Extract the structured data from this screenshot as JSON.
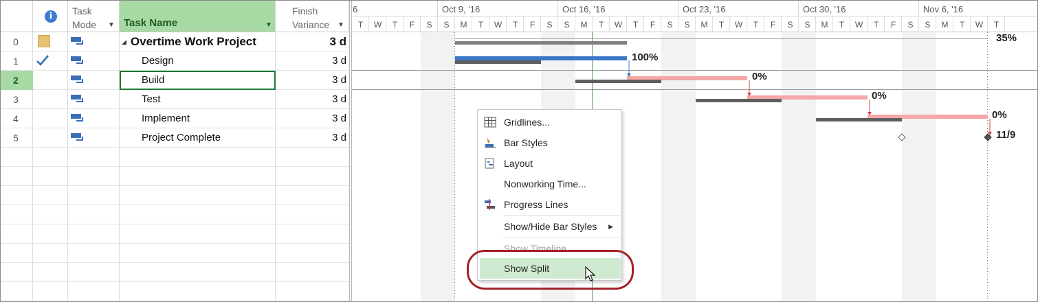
{
  "grid": {
    "headers": {
      "task_mode_line1": "Task",
      "task_mode_line2": "Mode",
      "task_name": "Task Name",
      "finish_variance_line1": "Finish",
      "finish_variance_line2": "Variance",
      "info_glyph": "i"
    },
    "rows": [
      {
        "id": "0",
        "name": "Overtime Work Project",
        "variance": "3 d",
        "indicator": "note-icon"
      },
      {
        "id": "1",
        "name": "Design",
        "variance": "3 d",
        "indicator": "check-icon"
      },
      {
        "id": "2",
        "name": "Build",
        "variance": "3 d",
        "indicator": ""
      },
      {
        "id": "3",
        "name": "Test",
        "variance": "3 d",
        "indicator": ""
      },
      {
        "id": "4",
        "name": "Implement",
        "variance": "3 d",
        "indicator": ""
      },
      {
        "id": "5",
        "name": "Project Complete",
        "variance": "3 d",
        "indicator": ""
      }
    ],
    "selected_row": "2"
  },
  "timescale": {
    "weeks": [
      "6",
      "Oct 9, '16",
      "Oct 16, '16",
      "Oct 23, '16",
      "Oct 30, '16",
      "Nov 6, '16"
    ],
    "day_letters": [
      "T",
      "W",
      "T",
      "F",
      "S",
      "S",
      "M",
      "T",
      "W",
      "T",
      "F",
      "S",
      "S",
      "M",
      "T",
      "W",
      "T",
      "F",
      "S",
      "S",
      "M",
      "T",
      "W",
      "T",
      "F",
      "S",
      "S",
      "M",
      "T",
      "W",
      "T",
      "F",
      "S",
      "S",
      "M",
      "T",
      "W",
      "T"
    ]
  },
  "gantt": {
    "labels": {
      "summary_pct": "35%",
      "design_pct": "100%",
      "build_pct": "0%",
      "test_pct": "0%",
      "implement_pct": "0%",
      "milestone_date": "11/9"
    },
    "colors": {
      "complete_bar": "#3a78c7",
      "critical_bar": "#f5a7a7",
      "baseline_bar": "#5f5f5f",
      "summary_bar": "#808080",
      "nonworking": "#f2f2f2"
    }
  },
  "context_menu": {
    "items": [
      {
        "label": "Gridlines...",
        "icon": "gridlines-icon",
        "disabled": false,
        "submenu": false
      },
      {
        "label": "Bar Styles",
        "icon": "bar-styles-icon",
        "disabled": false,
        "submenu": false
      },
      {
        "label": "Layout",
        "icon": "layout-icon",
        "disabled": false,
        "submenu": false
      },
      {
        "label": "Nonworking Time...",
        "icon": "",
        "disabled": false,
        "submenu": false
      },
      {
        "label": "Progress Lines",
        "icon": "progress-lines-icon",
        "disabled": false,
        "submenu": false
      },
      {
        "label": "Show/Hide Bar Styles",
        "icon": "",
        "disabled": false,
        "submenu": true
      },
      {
        "label": "Show Timeline",
        "icon": "",
        "disabled": true,
        "submenu": false
      },
      {
        "label": "Show Split",
        "icon": "",
        "disabled": false,
        "submenu": false,
        "hovered": true
      }
    ]
  }
}
